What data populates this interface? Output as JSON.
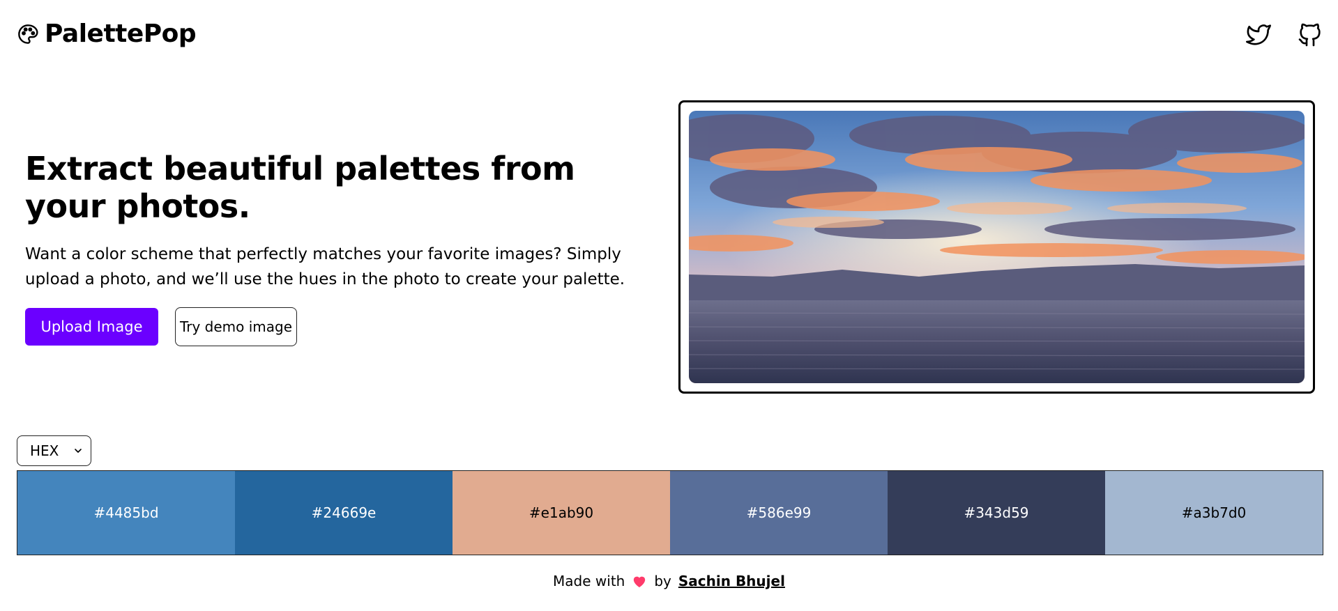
{
  "header": {
    "brand": "PalettePop",
    "icons": [
      "palette-icon",
      "twitter-icon",
      "github-icon"
    ]
  },
  "hero": {
    "title": "Extract beautiful palettes from your photos.",
    "description": "Want a color scheme that perfectly matches your favorite images? Simply upload a photo, and we’ll use the hues in the photo to create your palette.",
    "upload_label": "Upload Image",
    "demo_label": "Try demo image"
  },
  "format_select": {
    "selected": "HEX"
  },
  "palette": {
    "swatches": [
      {
        "hex": "#4485bd",
        "text_color": "#ffffff"
      },
      {
        "hex": "#24669e",
        "text_color": "#ffffff"
      },
      {
        "hex": "#e1ab90",
        "text_color": "#000000"
      },
      {
        "hex": "#586e99",
        "text_color": "#ffffff"
      },
      {
        "hex": "#343d59",
        "text_color": "#ffffff"
      },
      {
        "hex": "#a3b7d0",
        "text_color": "#000000"
      }
    ]
  },
  "footer": {
    "made_with": "Made with",
    "by": "by",
    "author": "Sachin Bhujel"
  },
  "colors": {
    "primary": "#6b00ff",
    "heart": "#ff3b6b"
  }
}
